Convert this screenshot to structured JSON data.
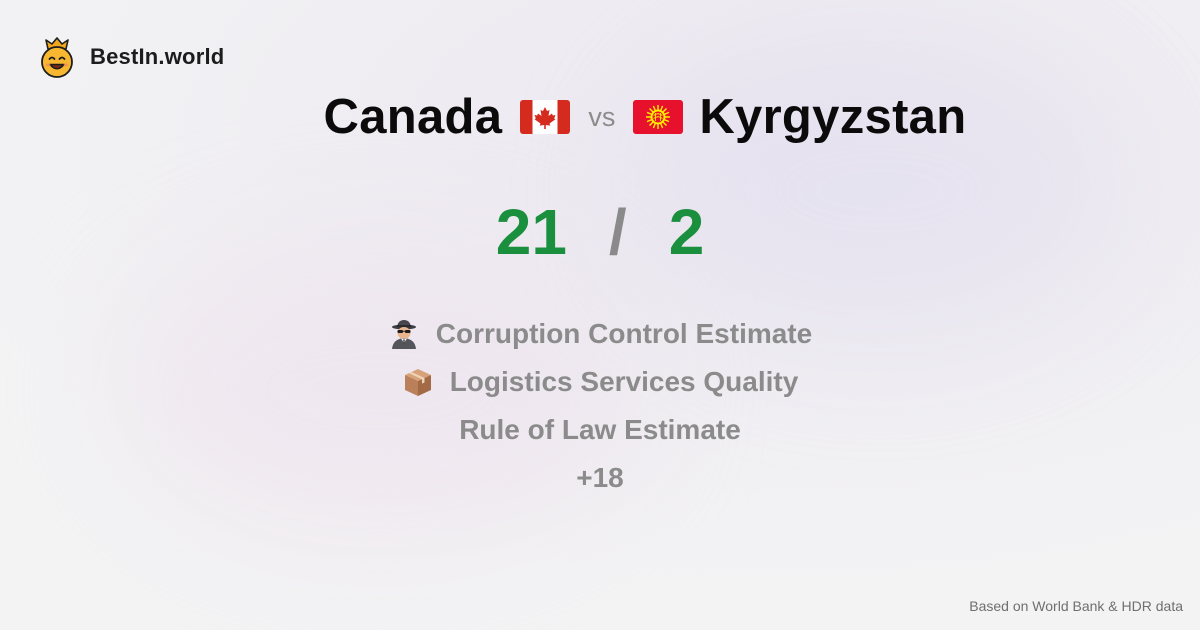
{
  "brand": {
    "name": "BestIn.world",
    "logo_icon": "crowned-smiley-icon"
  },
  "comparison": {
    "left_country": "Canada",
    "left_flag_icon": "canada-flag-icon",
    "vs_label": "vs",
    "right_country": "Kyrgyzstan",
    "right_flag_icon": "kyrgyzstan-flag-icon"
  },
  "score": {
    "left": "21",
    "separator": "/",
    "right": "2",
    "color": "#1a8f3d"
  },
  "metrics": [
    {
      "label": "Corruption Control Estimate",
      "icon": "spy-icon"
    },
    {
      "label": "Logistics Services Quality",
      "icon": "package-icon"
    },
    {
      "label": "Rule of Law Estimate",
      "icon": ""
    },
    {
      "label": "+18",
      "icon": ""
    }
  ],
  "footnote": "Based on World Bank & HDR data"
}
